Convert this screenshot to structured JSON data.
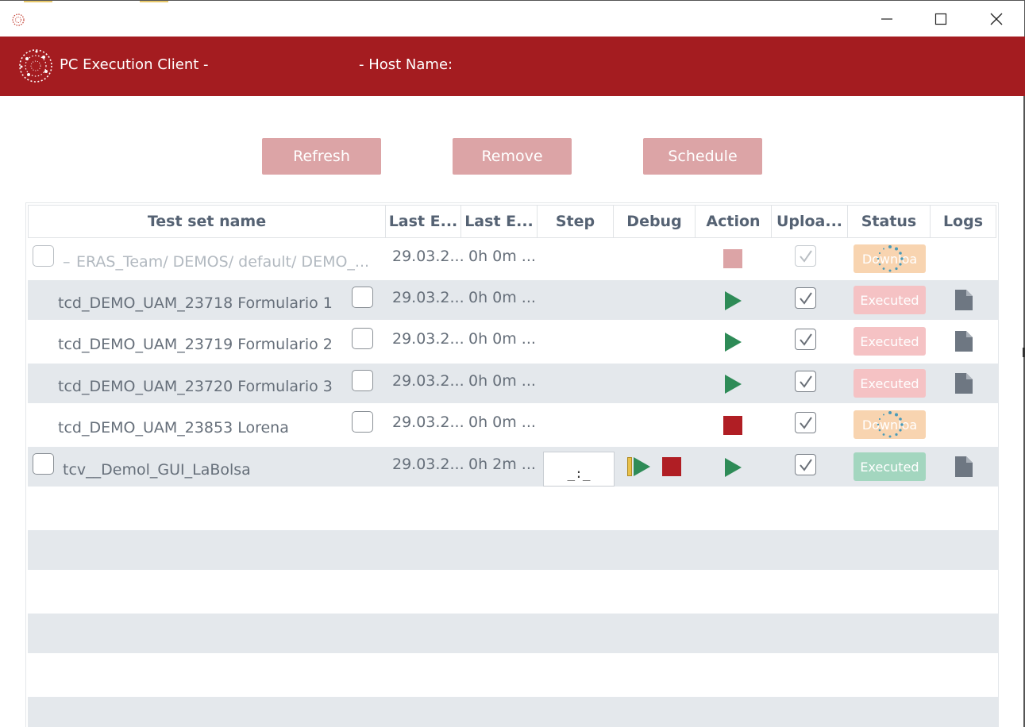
{
  "window": {
    "title": "",
    "controls": {
      "minimize": "minimize-icon",
      "maximize": "maximize-icon",
      "close": "close-icon"
    }
  },
  "header": {
    "app_title": "PC Execution Client -",
    "host_label": "- Host Name:"
  },
  "toolbar": {
    "refresh_label": "Refresh",
    "remove_label": "Remove",
    "schedule_label": "Schedule"
  },
  "table": {
    "columns": [
      "Test set name",
      "Last E...",
      "Last E...",
      "Step",
      "Debug",
      "Action",
      "Uploa...",
      "Status",
      "Logs"
    ],
    "rows": [
      {
        "name": "ERAS_Team/ DEMOS/ default/ DEMO_...",
        "prefix": "–",
        "last_exec_date": "29.03.2...",
        "last_exec_duration": "0h 0m ...",
        "action": "stop",
        "status": "Downloa",
        "level": "set",
        "muted": true
      },
      {
        "name": "tcd_DEMO_UAM_23718 Formulario 1",
        "last_exec_date": "29.03.2...",
        "last_exec_duration": "0h 0m ...",
        "action": "play",
        "status": "Executed",
        "level": "case"
      },
      {
        "name": "tcd_DEMO_UAM_23719 Formulario 2",
        "last_exec_date": "29.03.2...",
        "last_exec_duration": "0h 0m ...",
        "action": "play",
        "status": "Executed",
        "level": "case"
      },
      {
        "name": "tcd_DEMO_UAM_23720 Formulario 3",
        "last_exec_date": "29.03.2...",
        "last_exec_duration": "0h 0m ...",
        "action": "play",
        "status": "Executed",
        "level": "case"
      },
      {
        "name": "tcd_DEMO_UAM_23853 Lorena",
        "last_exec_date": "29.03.2...",
        "last_exec_duration": "0h 0m ...",
        "action": "stop",
        "status": "Downloa",
        "level": "case"
      },
      {
        "name": "tcv__Demol_GUI_LaBolsa",
        "last_exec_date": "29.03.2...",
        "last_exec_duration": "0h 2m ...",
        "step": "_:_",
        "action": "play",
        "status": "Executed",
        "level": "set"
      }
    ]
  },
  "colors": {
    "brand": "#a41c20",
    "button": "#dca4a6",
    "play": "#2e8b57",
    "stop": "#b01e24",
    "executed": "#f5c2c4",
    "executed_ok": "#a3d6bf",
    "downloading": "#f8d4b0",
    "row_alt": "#e4e8ec"
  }
}
